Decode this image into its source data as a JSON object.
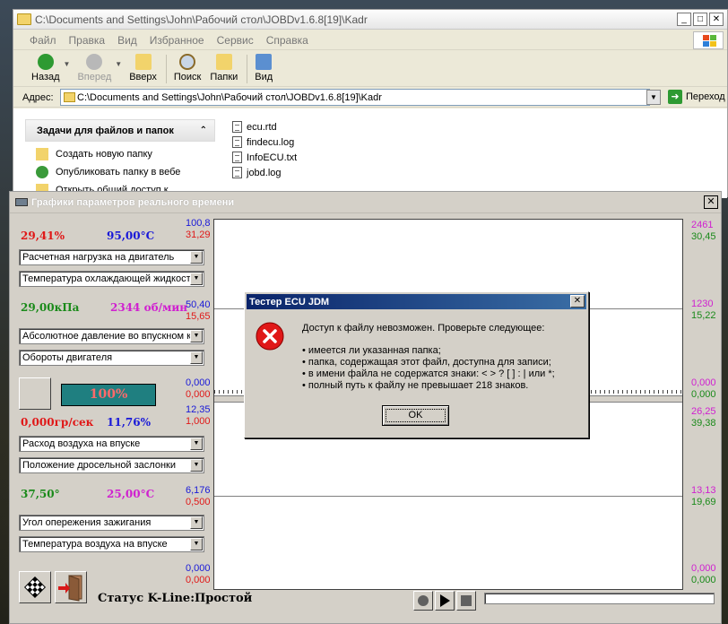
{
  "colors": {
    "red": "#e01818",
    "blue": "#1818d8",
    "green": "#1a8a1a",
    "magenta": "#d020d0",
    "teal": "#1f7f80",
    "salmon": "#ff6a6a"
  },
  "explorer": {
    "title": "C:\\Documents and Settings\\John\\Рабочий стол\\JOBDv1.6.8[19]\\Kadr",
    "window_buttons": [
      "_",
      "□",
      "✕"
    ],
    "menu": [
      "Файл",
      "Правка",
      "Вид",
      "Избранное",
      "Сервис",
      "Справка"
    ],
    "toolbar": {
      "back": "Назад",
      "forward": "Вперед",
      "up": "Вверх",
      "search": "Поиск",
      "folders": "Папки",
      "view": "Вид"
    },
    "address_label": "Адрес:",
    "address_value": "C:\\Documents and Settings\\John\\Рабочий стол\\JOBDv1.6.8[19]\\Kadr",
    "go_label": "Переход",
    "tasks": {
      "header": "Задачи для файлов и папок",
      "items": [
        "Создать новую папку",
        "Опубликовать папку в вебе",
        "Открыть общий доступ к"
      ]
    },
    "files": [
      "ecu.rtd",
      "findecu.log",
      "InfoECU.txt",
      "jobd.log"
    ]
  },
  "rt_window": {
    "title": "Графики параметров реального времени",
    "close": "✕",
    "blocks": [
      {
        "val_left": "29,41%",
        "val_left_color": "#e01818",
        "val_right": "95,00°C",
        "val_right_color": "#1818d8",
        "combo1": "Расчетная нагрузка на двигатель",
        "combo2": "Температура охлаждающей жидкости"
      },
      {
        "val_left": "29,00кПа",
        "val_left_color": "#1a8a1a",
        "val_right": "2344 об/мин",
        "val_right_color": "#d020d0",
        "combo1": "Абсолютное давление во впускном к",
        "combo2": "Обороты двигателя"
      },
      {
        "val_left": "0,000гр/сек",
        "val_left_color": "#e01818",
        "val_right": "11,76%",
        "val_right_color": "#1818d8",
        "combo1": "Расход воздуха на впуске",
        "combo2": "Положение дросельной заслонки"
      },
      {
        "val_left": "37,50°",
        "val_left_color": "#1a8a1a",
        "val_right": "25,00°C",
        "val_right_color": "#d020d0",
        "combo1": "Угол опережения зажигания",
        "combo2": "Температура воздуха на впуске"
      }
    ],
    "progress_label": "100%",
    "progress_value": 100,
    "scales_left": {
      "top_blue": "100,8",
      "top_red": "31,29",
      "mid1_blue": "50,40",
      "mid1_red": "15,65",
      "bot1_blue": "0,000",
      "bot1_red": "0,000",
      "top2_blue": "12,35",
      "top2_red": "1,000",
      "mid2_blue": "6,176",
      "mid2_red": "0,500",
      "bot2_blue": "0,000",
      "bot2_red": "0,000"
    },
    "scales_right": {
      "top_mag": "2461",
      "top_green": "30,45",
      "mid1_mag": "1230",
      "mid1_green": "15,22",
      "bot1_mag": "0,000",
      "bot1_green": "0,000",
      "top2_mag": "26,25",
      "top2_green": "39,38",
      "mid2_mag": "13,13",
      "mid2_green": "19,69",
      "bot2_mag": "0,000",
      "bot2_green": "0,000"
    },
    "status": "Статус K-Line:Простой"
  },
  "dialog": {
    "title": "Тестер ECU JDM",
    "close": "✕",
    "headline": "Доступ к файлу невозможен. Проверьте следующее:",
    "bullets": [
      "• имеется ли указанная папка;",
      "• папка, содержащая этот файл, доступна для записи;",
      "• в имени файла не содержатся знаки:  < > ? [ ] : | или *;",
      "• полный путь к файлу не превышает 218 знаков."
    ],
    "ok": "OK"
  }
}
